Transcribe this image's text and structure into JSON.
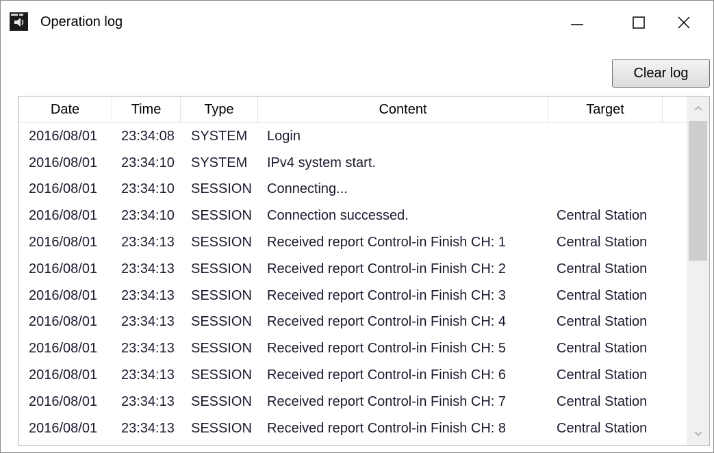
{
  "window": {
    "title": "Operation log",
    "icon": "app-icon",
    "controls": [
      "minimize-icon",
      "maximize-icon",
      "close-icon"
    ]
  },
  "toolbar": {
    "clear_label": "Clear log"
  },
  "columns": [
    "Date",
    "Time",
    "Type",
    "Content",
    "Target"
  ],
  "rows": [
    {
      "date": "2016/08/01",
      "time": "23:34:08",
      "type": "SYSTEM",
      "content": "Login",
      "target": ""
    },
    {
      "date": "2016/08/01",
      "time": "23:34:10",
      "type": "SYSTEM",
      "content": "IPv4 system start.",
      "target": ""
    },
    {
      "date": "2016/08/01",
      "time": "23:34:10",
      "type": "SESSION",
      "content": "Connecting...",
      "target": ""
    },
    {
      "date": "2016/08/01",
      "time": "23:34:10",
      "type": "SESSION",
      "content": "Connection successed.",
      "target": "Central Station"
    },
    {
      "date": "2016/08/01",
      "time": "23:34:13",
      "type": "SESSION",
      "content": "Received report Control-in Finish CH: 1",
      "target": "Central Station"
    },
    {
      "date": "2016/08/01",
      "time": "23:34:13",
      "type": "SESSION",
      "content": "Received report Control-in Finish CH: 2",
      "target": "Central Station"
    },
    {
      "date": "2016/08/01",
      "time": "23:34:13",
      "type": "SESSION",
      "content": "Received report Control-in Finish CH: 3",
      "target": "Central Station"
    },
    {
      "date": "2016/08/01",
      "time": "23:34:13",
      "type": "SESSION",
      "content": "Received report Control-in Finish CH: 4",
      "target": "Central Station"
    },
    {
      "date": "2016/08/01",
      "time": "23:34:13",
      "type": "SESSION",
      "content": "Received report Control-in Finish CH: 5",
      "target": "Central Station"
    },
    {
      "date": "2016/08/01",
      "time": "23:34:13",
      "type": "SESSION",
      "content": "Received report Control-in Finish CH: 6",
      "target": "Central Station"
    },
    {
      "date": "2016/08/01",
      "time": "23:34:13",
      "type": "SESSION",
      "content": "Received report Control-in Finish CH: 7",
      "target": "Central Station"
    },
    {
      "date": "2016/08/01",
      "time": "23:34:13",
      "type": "SESSION",
      "content": "Received report Control-in Finish CH: 8",
      "target": "Central Station"
    }
  ],
  "colors": {
    "text": "#1a1a2e",
    "scrollbar_track": "#f0f0f0",
    "scrollbar_thumb": "#cdcdcd"
  }
}
